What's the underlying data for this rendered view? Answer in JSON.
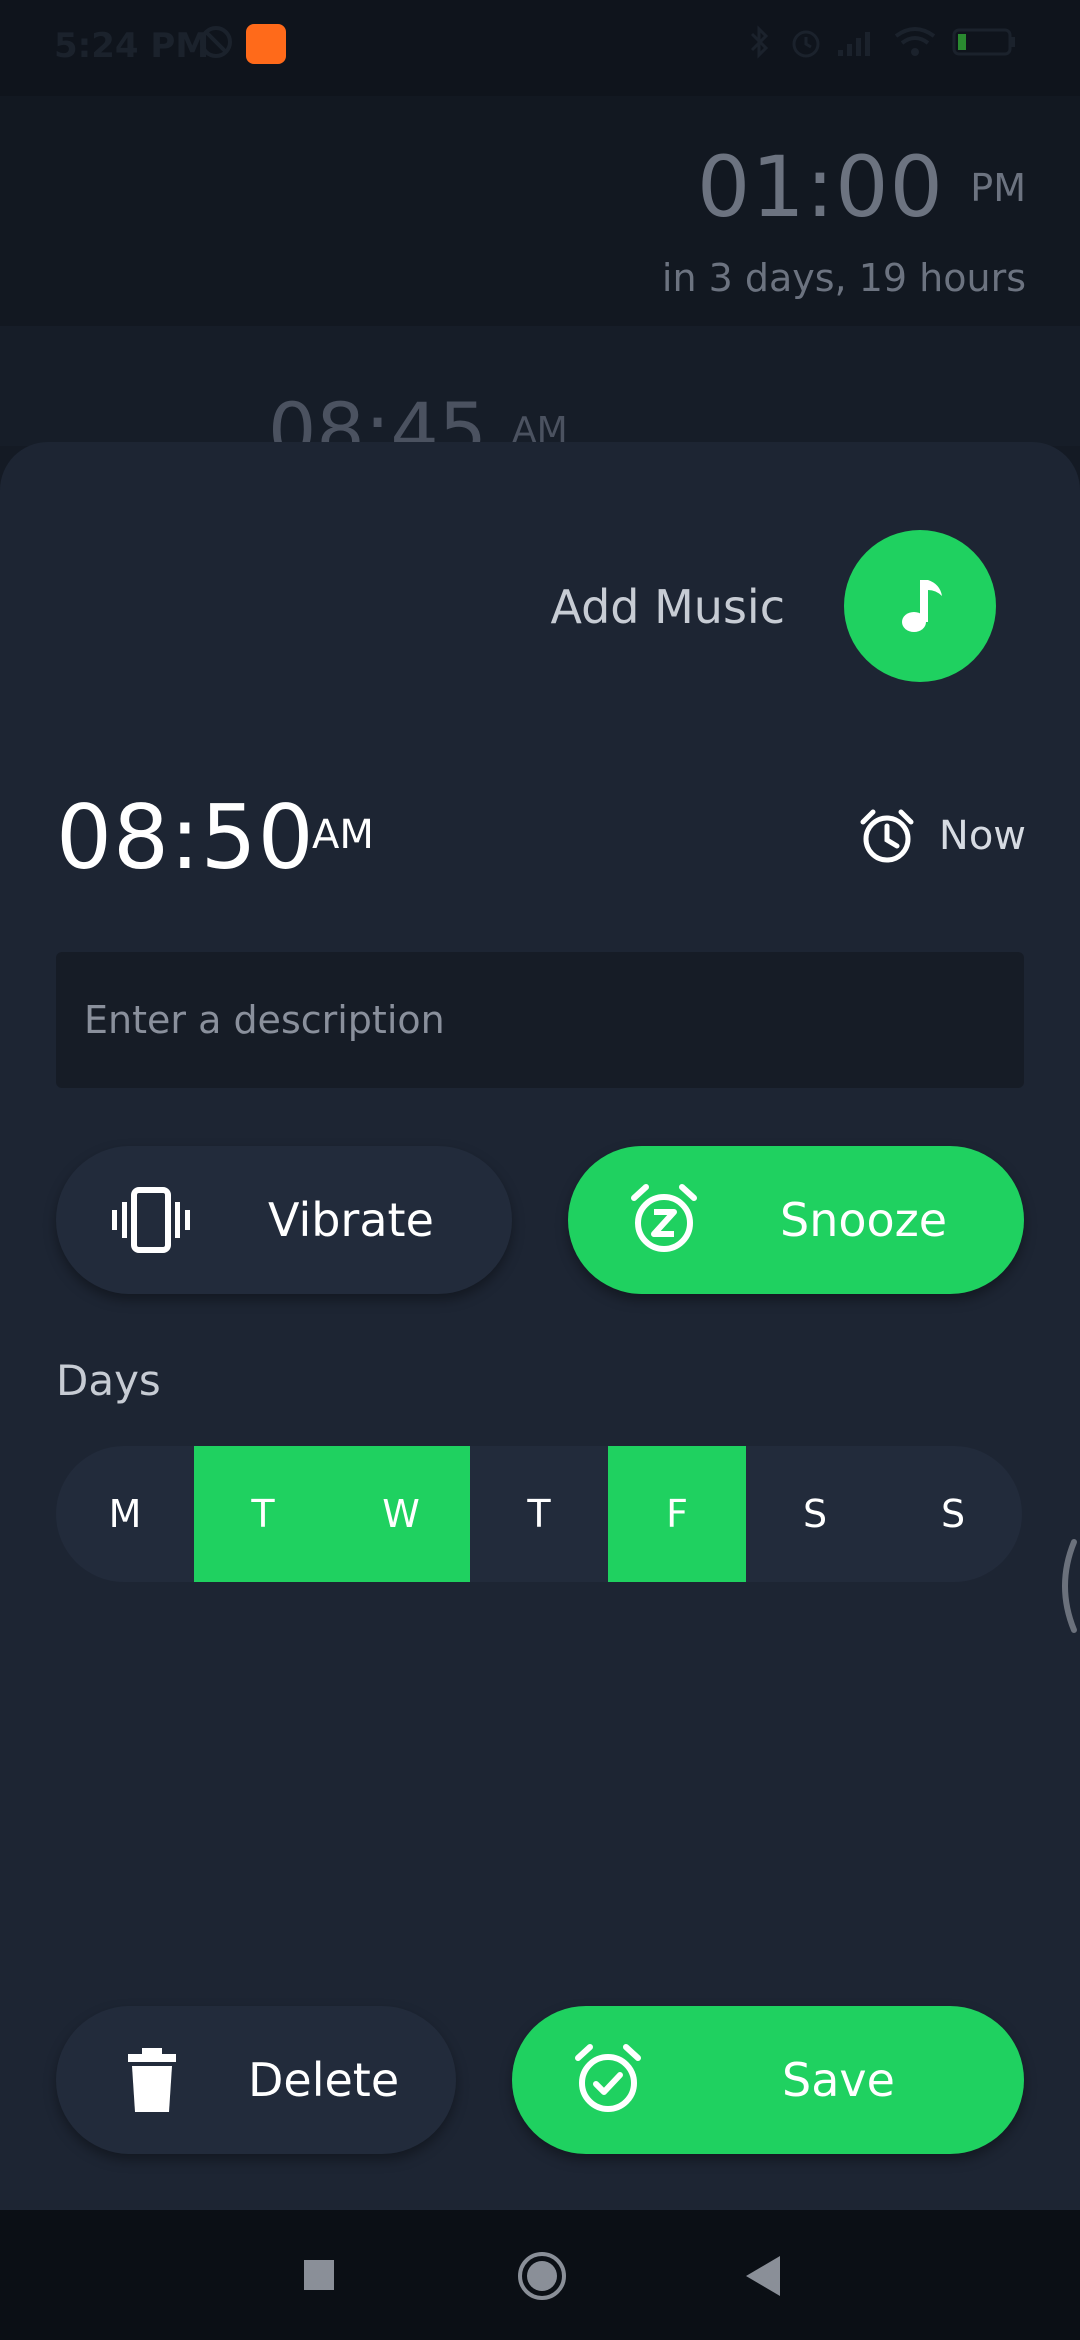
{
  "status_bar": {
    "time": "5:24 PM"
  },
  "background": {
    "next_alarm_time": "01:00",
    "next_alarm_ampm": "PM",
    "next_alarm_eta": "in 3 days, 19 hours",
    "list_item_time": "08:45",
    "list_item_ampm": "AM"
  },
  "sheet": {
    "add_music_label": "Add Music",
    "time": "08:50",
    "ampm": "AM",
    "now_label": "Now",
    "description_placeholder": "Enter a description",
    "vibrate_label": "Vibrate",
    "snooze_label": "Snooze",
    "days_label": "Days",
    "days": [
      {
        "letter": "M",
        "selected": false
      },
      {
        "letter": "T",
        "selected": true
      },
      {
        "letter": "W",
        "selected": true
      },
      {
        "letter": "T",
        "selected": false
      },
      {
        "letter": "F",
        "selected": true
      },
      {
        "letter": "S",
        "selected": false
      },
      {
        "letter": "S",
        "selected": false
      }
    ],
    "delete_label": "Delete",
    "save_label": "Save"
  },
  "colors": {
    "accent": "#1fd160",
    "sheet": "#1d2533",
    "pill_dark": "#222b3b"
  },
  "icons": [
    "music-note-icon",
    "alarm-clock-icon",
    "vibrate-icon",
    "snooze-icon",
    "trash-icon",
    "alarm-check-icon",
    "nav-recents-icon",
    "nav-home-icon",
    "nav-back-icon"
  ]
}
